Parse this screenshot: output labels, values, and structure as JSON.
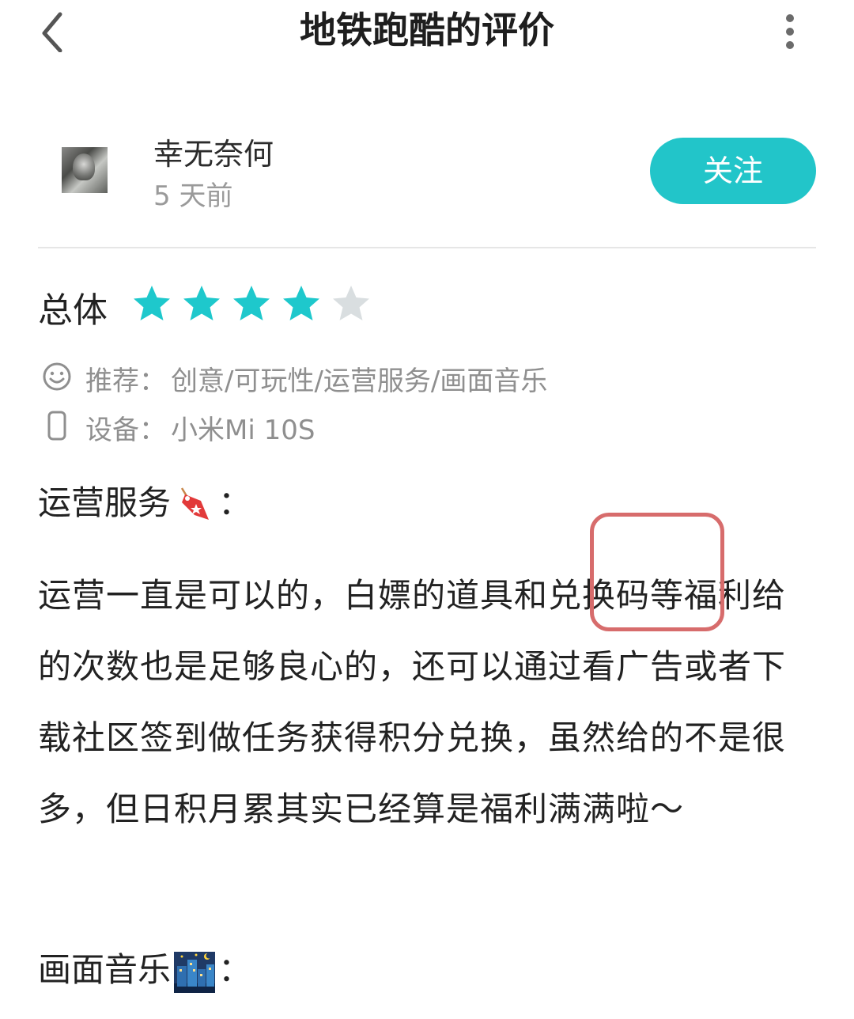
{
  "header": {
    "title": "地铁跑酷的评价",
    "back_icon": "chevron-left-icon",
    "more_icon": "more-vertical-icon"
  },
  "author": {
    "name": "幸无奈何",
    "time": "5 天前",
    "follow_label": "关注"
  },
  "rating": {
    "label": "总体",
    "score": 4,
    "max": 5,
    "filled_color": "#1ec8cc",
    "empty_color": "#d9dee0"
  },
  "info": {
    "recommend_label": "推荐：",
    "recommend_value": "创意/可玩性/运营服务/画面音乐",
    "device_label": "设备：",
    "device_value": "小米Mi 10S"
  },
  "review": {
    "section1_title": "运营服务",
    "section1_colon": "：",
    "section1_emoji": "tag-emoji",
    "paragraph": "运营一直是可以的，白嫖的道具和兑换码等福利给的次数也是足够良心的，还可以通过看广告或者下载社区签到做任务获得积分兑换，虽然给的不是很多，但日积月累其实已经算是福利满满啦～",
    "section2_title": "画面音乐",
    "section2_colon": "：",
    "section2_emoji": "night-city-emoji"
  },
  "colors": {
    "accent": "#22c5c9",
    "highlight_box": "#d76c6c",
    "muted_text": "#8f8f8f"
  }
}
